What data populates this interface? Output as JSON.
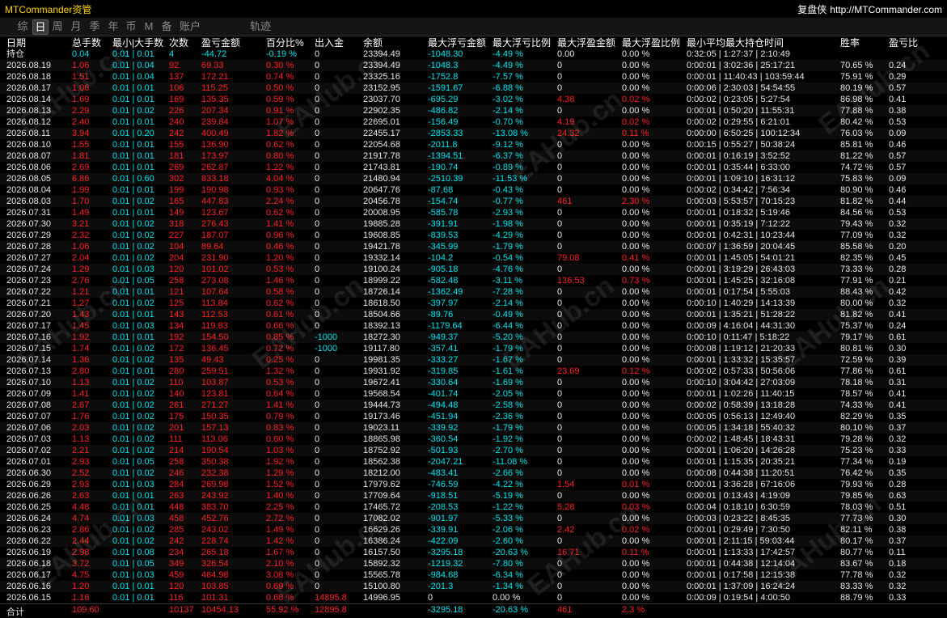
{
  "window": {
    "title": "MTCommander资管",
    "brand": "复盘侠",
    "url": "http://MTCommander.com"
  },
  "tabs": [
    {
      "label": "综",
      "active": false
    },
    {
      "label": "日",
      "active": true
    },
    {
      "label": "周",
      "active": false
    },
    {
      "label": "月",
      "active": false
    },
    {
      "label": "季",
      "active": false
    },
    {
      "label": "年",
      "active": false
    },
    {
      "label": "币",
      "active": false
    },
    {
      "label": "M",
      "active": false
    },
    {
      "label": "备",
      "active": false
    },
    {
      "label": "账户",
      "active": false
    },
    {
      "label": "轨迹",
      "active": false
    }
  ],
  "columns": [
    "日期",
    "总手数",
    "最小|大手数",
    "次数",
    "盈亏金额",
    "百分比%",
    "出入金",
    "余额",
    "最大浮亏金额",
    "最大浮亏比例",
    "最大浮盈金额",
    "最大浮盈比例",
    "最小平均最大持仓时间",
    "胜率",
    "盈亏比"
  ],
  "holding": [
    "持仓",
    "0.04",
    "0.01 | 0.01",
    "4",
    "-44.72",
    "-0.19 %",
    "0",
    "23394.49",
    "-1048.30",
    "-4.49 %",
    "0.00",
    "0.00 %",
    "0:32:05 | 1:27:37 | 2:10:49",
    "",
    ""
  ],
  "rows": [
    [
      "2026.08.19",
      "1.06",
      "0.01 | 0.04",
      "92",
      "69.33",
      "0.30 %",
      "0",
      "23394.49",
      "-1048.3",
      "-4.49 %",
      "0",
      "0.00 %",
      "0:00:01 | 3:02:36 | 25:17:21",
      "70.65 %",
      "0.24"
    ],
    [
      "2026.08.18",
      "1.51",
      "0.01 | 0.04",
      "137",
      "172.21",
      "0.74 %",
      "0",
      "23325.16",
      "-1752.8",
      "-7.57 %",
      "0",
      "0.00 %",
      "0:00:01 | 11:40:43 | 103:59:44",
      "75.91 %",
      "0.29"
    ],
    [
      "2026.08.17",
      "1.06",
      "0.01 | 0.01",
      "106",
      "115.25",
      "0.50 %",
      "0",
      "23152.95",
      "-1591.67",
      "-6.88 %",
      "0",
      "0.00 %",
      "0:00:06 | 2:30:03 | 54:54:55",
      "80.19 %",
      "0.57"
    ],
    [
      "2026.08.14",
      "1.69",
      "0.01 | 0.01",
      "169",
      "135.35",
      "0.59 %",
      "0",
      "23037.70",
      "-695.29",
      "-3.02 %",
      "4.38",
      "0.02 %",
      "0:00:02 | 0:23:05 | 5:27:54",
      "86.98 %",
      "0.41"
    ],
    [
      "2026.08.13",
      "2.29",
      "0.01 | 0.02",
      "226",
      "207.34",
      "0.91 %",
      "0",
      "22902.35",
      "-486.82",
      "-2.14 %",
      "0",
      "0.00 %",
      "0:00:01 | 0:50:20 | 11:55:31",
      "77.88 %",
      "0.38"
    ],
    [
      "2026.08.12",
      "2.40",
      "0.01 | 0.01",
      "240",
      "239.84",
      "1.07 %",
      "0",
      "22695.01",
      "-156.49",
      "-0.70 %",
      "4.19",
      "0.02 %",
      "0:00:02 | 0:29:55 | 6:21:01",
      "80.42 %",
      "0.53"
    ],
    [
      "2026.08.11",
      "3.94",
      "0.01 | 0.20",
      "242",
      "400.49",
      "1.82 %",
      "0",
      "22455.17",
      "-2853.33",
      "-13.08 %",
      "24.32",
      "0.11 %",
      "0:00:00 | 6:50:25 | 100:12:34",
      "76.03 %",
      "0.09"
    ],
    [
      "2026.08.10",
      "1.55",
      "0.01 | 0.01",
      "155",
      "136.90",
      "0.62 %",
      "0",
      "22054.68",
      "-2011.8",
      "-9.12 %",
      "0",
      "0.00 %",
      "0:00:15 | 0:55:27 | 50:38:24",
      "85.81 %",
      "0.46"
    ],
    [
      "2026.08.07",
      "1.81",
      "0.01 | 0.01",
      "181",
      "173.97",
      "0.80 %",
      "0",
      "21917.78",
      "-1394.51",
      "-6.37 %",
      "0",
      "0.00 %",
      "0:00:01 | 0:16:19 | 3:52:52",
      "81.22 %",
      "0.57"
    ],
    [
      "2026.08.06",
      "2.69",
      "0.01 | 0.01",
      "269",
      "262.87",
      "1.22 %",
      "0",
      "21743.81",
      "-190.74",
      "-0.89 %",
      "0",
      "0.00 %",
      "0:00:01 | 0:35:44 | 6:33:00",
      "74.72 %",
      "0.57"
    ],
    [
      "2026.08.05",
      "6.86",
      "0.01 | 0.60",
      "302",
      "833.18",
      "4.04 %",
      "0",
      "21480.94",
      "-2510.39",
      "-11.53 %",
      "0",
      "0.00 %",
      "0:00:01 | 1:09:10 | 16:31:12",
      "75.83 %",
      "0.09"
    ],
    [
      "2026.08.04",
      "1.99",
      "0.01 | 0.01",
      "199",
      "190.98",
      "0.93 %",
      "0",
      "20647.76",
      "-87.68",
      "-0.43 %",
      "0",
      "0.00 %",
      "0:00:02 | 0:34:42 | 7:56:34",
      "80.90 %",
      "0.46"
    ],
    [
      "2026.08.03",
      "1.70",
      "0.01 | 0.02",
      "165",
      "447.83",
      "2.24 %",
      "0",
      "20456.78",
      "-154.74",
      "-0.77 %",
      "461",
      "2.30 %",
      "0:00:03 | 5:53:57 | 70:15:23",
      "81.82 %",
      "0.44"
    ],
    [
      "2026.07.31",
      "1.49",
      "0.01 | 0.01",
      "149",
      "123.67",
      "0.62 %",
      "0",
      "20008.95",
      "-585.78",
      "-2.93 %",
      "0",
      "0.00 %",
      "0:00:01 | 0:18:32 | 5:19:46",
      "84.56 %",
      "0.53"
    ],
    [
      "2026.07.30",
      "3.21",
      "0.01 | 0.02",
      "318",
      "276.43",
      "1.41 %",
      "0",
      "19885.28",
      "-391.91",
      "-1.98 %",
      "0",
      "0.00 %",
      "0:00:01 | 0:35:19 | 7:12:22",
      "79.43 %",
      "0.32"
    ],
    [
      "2026.07.29",
      "2.32",
      "0.01 | 0.02",
      "227",
      "187.07",
      "0.96 %",
      "0",
      "19608.85",
      "-839.53",
      "-4.29 %",
      "0",
      "0.00 %",
      "0:00:01 | 0:42:31 | 10:23:44",
      "77.09 %",
      "0.32"
    ],
    [
      "2026.07.28",
      "1.06",
      "0.01 | 0.02",
      "104",
      "89.64",
      "0.46 %",
      "0",
      "19421.78",
      "-345.99",
      "-1.79 %",
      "0",
      "0.00 %",
      "0:00:07 | 1:36:59 | 20:04:45",
      "85.58 %",
      "0.20"
    ],
    [
      "2026.07.27",
      "2.04",
      "0.01 | 0.02",
      "204",
      "231.90",
      "1.20 %",
      "0",
      "19332.14",
      "-104.2",
      "-0.54 %",
      "79.08",
      "0.41 %",
      "0:00:01 | 1:45:05 | 54:01:21",
      "82.35 %",
      "0.45"
    ],
    [
      "2026.07.24",
      "1.29",
      "0.01 | 0.03",
      "120",
      "101.02",
      "0.53 %",
      "0",
      "19100.24",
      "-905.18",
      "-4.76 %",
      "0",
      "0.00 %",
      "0:00:01 | 3:19:29 | 26:43:03",
      "73.33 %",
      "0.28"
    ],
    [
      "2026.07.23",
      "2.76",
      "0.01 | 0.05",
      "258",
      "273.08",
      "1.46 %",
      "0",
      "18999.22",
      "-582.48",
      "-3.11 %",
      "136.53",
      "0.73 %",
      "0:00:01 | 1:45:25 | 32:16:08",
      "77.91 %",
      "0.21"
    ],
    [
      "2026.07.22",
      "1.21",
      "0.01 | 0.01",
      "121",
      "107.64",
      "0.58 %",
      "0",
      "18726.14",
      "-1362.49",
      "-7.28 %",
      "0",
      "0.00 %",
      "0:00:01 | 0:17:54 | 5:55:03",
      "88.43 %",
      "0.42"
    ],
    [
      "2026.07.21",
      "1.27",
      "0.01 | 0.02",
      "125",
      "113.84",
      "0.62 %",
      "0",
      "18618.50",
      "-397.97",
      "-2.14 %",
      "0",
      "0.00 %",
      "0:00:10 | 1:40:29 | 14:13:39",
      "80.00 %",
      "0.32"
    ],
    [
      "2026.07.20",
      "1.43",
      "0.01 | 0.01",
      "143",
      "112.53",
      "0.61 %",
      "0",
      "18504.66",
      "-89.76",
      "-0.49 %",
      "0",
      "0.00 %",
      "0:00:01 | 1:35:21 | 51:28:22",
      "81.82 %",
      "0.41"
    ],
    [
      "2026.07.17",
      "1.45",
      "0.01 | 0.03",
      "134",
      "119.83",
      "0.66 %",
      "0",
      "18392.13",
      "-1179.64",
      "-6.44 %",
      "0",
      "0.00 %",
      "0:00:09 | 4:16:04 | 44:31:30",
      "75.37 %",
      "0.24"
    ],
    [
      "2026.07.16",
      "1.92",
      "0.01 | 0.01",
      "192",
      "154.50",
      "0.85 %",
      "-1000",
      "18272.30",
      "-949.37",
      "-5.20 %",
      "0",
      "0.00 %",
      "0:00:10 | 0:11:47 | 5:18:22",
      "79.17 %",
      "0.61"
    ],
    [
      "2026.07.15",
      "1.74",
      "0.01 | 0.02",
      "172",
      "136.45",
      "0.72 %",
      "-1000",
      "19117.80",
      "-357.41",
      "-1.79 %",
      "0",
      "0.00 %",
      "0:00:08 | 1:19:12 | 21:20:33",
      "80.81 %",
      "0.30"
    ],
    [
      "2026.07.14",
      "1.36",
      "0.01 | 0.02",
      "135",
      "49.43",
      "0.25 %",
      "0",
      "19981.35",
      "-333.27",
      "-1.67 %",
      "0",
      "0.00 %",
      "0:00:01 | 1:33:32 | 15:35:57",
      "72.59 %",
      "0.39"
    ],
    [
      "2026.07.13",
      "2.80",
      "0.01 | 0.01",
      "280",
      "259.51",
      "1.32 %",
      "0",
      "19931.92",
      "-319.85",
      "-1.61 %",
      "23.69",
      "0.12 %",
      "0:00:02 | 0:57:33 | 50:56:06",
      "77.86 %",
      "0.61"
    ],
    [
      "2026.07.10",
      "1.13",
      "0.01 | 0.02",
      "110",
      "103.87",
      "0.53 %",
      "0",
      "19672.41",
      "-330.64",
      "-1.69 %",
      "0",
      "0.00 %",
      "0:00:10 | 3:04:42 | 27:03:09",
      "78.18 %",
      "0.31"
    ],
    [
      "2026.07.09",
      "1.41",
      "0.01 | 0.02",
      "140",
      "123.81",
      "0.64 %",
      "0",
      "19568.54",
      "-401.74",
      "-2.05 %",
      "0",
      "0.00 %",
      "0:00:01 | 1:02:26 | 11:40:15",
      "78.57 %",
      "0.41"
    ],
    [
      "2026.07.08",
      "2.67",
      "0.01 | 0.02",
      "261",
      "271.27",
      "1.41 %",
      "0",
      "19444.73",
      "-494.48",
      "-2.58 %",
      "0",
      "0.00 %",
      "0:00:02 | 0:58:39 | 13:18:28",
      "74.33 %",
      "0.41"
    ],
    [
      "2026.07.07",
      "1.76",
      "0.01 | 0.02",
      "175",
      "150.35",
      "0.79 %",
      "0",
      "19173.46",
      "-451.94",
      "-2.36 %",
      "0",
      "0.00 %",
      "0:00:05 | 0:56:13 | 12:49:40",
      "82.29 %",
      "0.35"
    ],
    [
      "2026.07.06",
      "2.03",
      "0.01 | 0.02",
      "201",
      "157.13",
      "0.83 %",
      "0",
      "19023.11",
      "-339.92",
      "-1.79 %",
      "0",
      "0.00 %",
      "0:00:05 | 1:34:18 | 55:40:32",
      "80.10 %",
      "0.37"
    ],
    [
      "2026.07.03",
      "1.13",
      "0.01 | 0.02",
      "111",
      "113.06",
      "0.60 %",
      "0",
      "18865.98",
      "-360.54",
      "-1.92 %",
      "0",
      "0.00 %",
      "0:00:02 | 1:48:45 | 18:43:31",
      "79.28 %",
      "0.32"
    ],
    [
      "2026.07.02",
      "2.21",
      "0.01 | 0.02",
      "214",
      "190.54",
      "1.03 %",
      "0",
      "18752.92",
      "-501.93",
      "-2.70 %",
      "0",
      "0.00 %",
      "0:00:01 | 1:06:20 | 14:26:28",
      "75.23 %",
      "0.33"
    ],
    [
      "2026.07.01",
      "2.93",
      "0.01 | 0.05",
      "258",
      "350.38",
      "1.92 %",
      "0",
      "18562.38",
      "-2047.21",
      "-11.08 %",
      "0",
      "0.00 %",
      "0:00:01 | 1:15:35 | 20:35:21",
      "77.34 %",
      "0.19"
    ],
    [
      "2026.06.30",
      "2.52",
      "0.01 | 0.02",
      "246",
      "232.38",
      "1.29 %",
      "0",
      "18212.00",
      "-483.41",
      "-2.66 %",
      "0",
      "0.00 %",
      "0:00:08 | 0:44:38 | 11:20:51",
      "76.42 %",
      "0.35"
    ],
    [
      "2026.06.29",
      "2.93",
      "0.01 | 0.03",
      "284",
      "269.98",
      "1.52 %",
      "0",
      "17979.62",
      "-746.59",
      "-4.22 %",
      "1.54",
      "0.01 %",
      "0:00:01 | 3:36:28 | 67:16:06",
      "79.93 %",
      "0.28"
    ],
    [
      "2026.06.26",
      "2.63",
      "0.01 | 0.01",
      "263",
      "243.92",
      "1.40 %",
      "0",
      "17709.64",
      "-918.51",
      "-5.19 %",
      "0",
      "0.00 %",
      "0:00:01 | 0:13:43 | 4:19:09",
      "79.85 %",
      "0.63"
    ],
    [
      "2026.06.25",
      "4.48",
      "0.01 | 0.01",
      "448",
      "383.70",
      "2.25 %",
      "0",
      "17465.72",
      "-208.53",
      "-1.22 %",
      "5.28",
      "0.03 %",
      "0:00:04 | 0:18:10 | 6:30:59",
      "78.03 %",
      "0.51"
    ],
    [
      "2026.06.24",
      "4.74",
      "0.01 | 0.03",
      "458",
      "452.76",
      "2.72 %",
      "0",
      "17082.02",
      "-901.97",
      "-5.33 %",
      "0",
      "0.00 %",
      "0:00:03 | 0:23:22 | 8:45:35",
      "77.73 %",
      "0.30"
    ],
    [
      "2026.06.23",
      "2.86",
      "0.01 | 0.02",
      "285",
      "243.02",
      "1.49 %",
      "0",
      "16629.26",
      "-339.91",
      "-2.06 %",
      "2.42",
      "0.02 %",
      "0:00:01 | 0:29:49 | 7:30:50",
      "82.11 %",
      "0.38"
    ],
    [
      "2026.06.22",
      "2.44",
      "0.01 | 0.02",
      "242",
      "228.74",
      "1.42 %",
      "0",
      "16386.24",
      "-422.09",
      "-2.60 %",
      "0",
      "0.00 %",
      "0:00:01 | 2:11:15 | 59:03:44",
      "80.17 %",
      "0.37"
    ],
    [
      "2026.06.19",
      "2.98",
      "0.01 | 0.08",
      "234",
      "265.18",
      "1.67 %",
      "0",
      "16157.50",
      "-3295.18",
      "-20.63 %",
      "16.71",
      "0.11 %",
      "0:00:01 | 1:13:33 | 17:42:57",
      "80.77 %",
      "0.11"
    ],
    [
      "2026.06.18",
      "3.72",
      "0.01 | 0.05",
      "349",
      "326.54",
      "2.10 %",
      "0",
      "15892.32",
      "-1219.32",
      "-7.80 %",
      "0",
      "0.00 %",
      "0:00:01 | 0:44:38 | 12:14:04",
      "83.67 %",
      "0.18"
    ],
    [
      "2026.06.17",
      "4.75",
      "0.01 | 0.03",
      "459",
      "464.98",
      "3.08 %",
      "0",
      "15565.78",
      "-984.68",
      "-6.34 %",
      "0",
      "0.00 %",
      "0:00:01 | 0:17:58 | 12:15:38",
      "77.78 %",
      "0.32"
    ],
    [
      "2026.06.16",
      "1.20",
      "0.01 | 0.01",
      "120",
      "103.85",
      "0.69 %",
      "0",
      "15100.80",
      "-201.3",
      "-1.34 %",
      "0",
      "0.00 %",
      "0:00:01 | 1:37:09 | 16:24:24",
      "83.33 %",
      "0.32"
    ],
    [
      "2026.06.15",
      "1.16",
      "0.01 | 0.01",
      "116",
      "101.31",
      "0.68 %",
      "14895.8",
      "14996.95",
      "0",
      "0.00 %",
      "0",
      "0.00 %",
      "0:00:09 | 0:19:54 | 4:00:50",
      "88.79 %",
      "0.33"
    ]
  ],
  "total": [
    "合计",
    "109.60",
    "",
    "10137",
    "10454.13",
    "55.92 %",
    "12895.8",
    "",
    "-3295.18",
    "-20.63 %",
    "461",
    "2.3 %",
    "",
    "",
    ""
  ],
  "watermark": "EAHub.cn",
  "colors": {
    "positive": "#ff2020",
    "negative": "#00e5ee",
    "neutral": "#e8e8e8",
    "title": "#ffd700"
  }
}
